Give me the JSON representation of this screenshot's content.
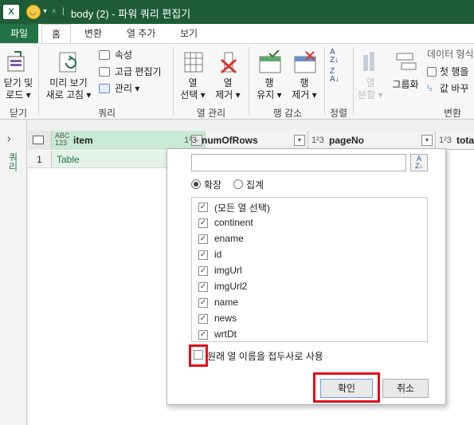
{
  "titlebar": {
    "excel_icon": "X",
    "title": "body (2) - 파워 쿼리 편집기"
  },
  "tabs": [
    {
      "label": "파일"
    },
    {
      "label": "홈"
    },
    {
      "label": "변환"
    },
    {
      "label": "열 추가"
    },
    {
      "label": "보기"
    }
  ],
  "ribbon": {
    "close_load_1": "닫기 및",
    "close_load_2": "로드 ▾",
    "preview_1": "미리 보기",
    "preview_2": "새로 고침 ▾",
    "properties": "속성",
    "advanced_editor": "고급 편집기",
    "manage": "관리 ▾",
    "choose_cols_1": "열",
    "choose_cols_2": "선택 ▾",
    "remove_cols_1": "열",
    "remove_cols_2": "제거 ▾",
    "keep_rows_1": "행",
    "keep_rows_2": "유지 ▾",
    "remove_rows_1": "행",
    "remove_rows_2": "제거 ▾",
    "split_col_1": "열",
    "split_col_2": "분할 ▾",
    "group_by": "그룹화",
    "data_type": "데이터 형식",
    "first_row_header": "첫 행을",
    "replace_values": "값 바꾸",
    "groups": {
      "close": "닫기",
      "query": "쿼리",
      "manage_cols": "열 관리",
      "reduce_rows": "행 감소",
      "sort": "정렬",
      "transform": "변환"
    }
  },
  "left_pane": {
    "label": "쿼리"
  },
  "grid": {
    "columns": [
      {
        "type": "ABC\n123",
        "name": "item"
      },
      {
        "type": "1²3",
        "name": "numOfRows"
      },
      {
        "type": "1²3",
        "name": "pageNo"
      },
      {
        "type": "1²3",
        "name": "total"
      }
    ],
    "rows": [
      {
        "num": "1",
        "item": "Table"
      }
    ]
  },
  "popup": {
    "search_value": "",
    "mode_expand": "확장",
    "mode_aggregate": "집계",
    "columns": [
      {
        "label": "(모든 열 선택)",
        "checked": true
      },
      {
        "label": "continent",
        "checked": true
      },
      {
        "label": "ename",
        "checked": true
      },
      {
        "label": "id",
        "checked": true
      },
      {
        "label": "imgUrl",
        "checked": true
      },
      {
        "label": "imgUrl2",
        "checked": true
      },
      {
        "label": "name",
        "checked": true
      },
      {
        "label": "news",
        "checked": true
      },
      {
        "label": "wrtDt",
        "checked": true
      }
    ],
    "use_original_prefix": "원래 열 이름을 접두사로 사용",
    "ok": "확인",
    "cancel": "취소"
  }
}
